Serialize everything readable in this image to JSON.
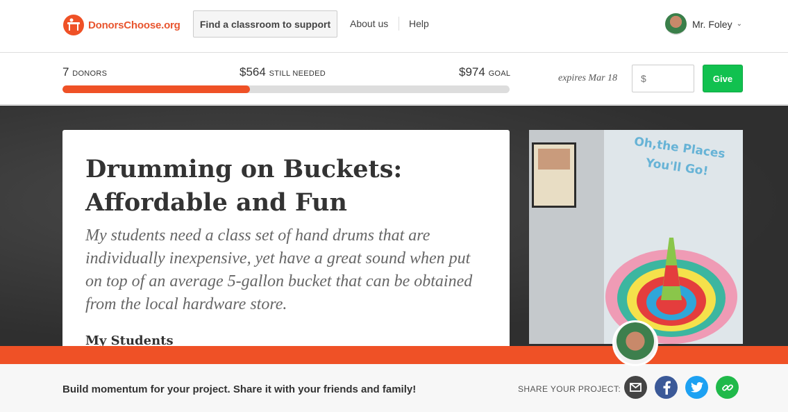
{
  "header": {
    "logo_text": "DonorsChoose.org",
    "find_button": "Find a classroom to support",
    "nav": [
      "About us",
      "Help"
    ],
    "user_name": "Mr. Foley"
  },
  "progress": {
    "donors_count": "7",
    "donors_label": "DONORS",
    "needed_amount": "$564",
    "needed_label": "STILL NEEDED",
    "goal_amount": "$974",
    "goal_label": "GOAL",
    "funded_fraction": 0.42,
    "expires": "expires Mar 18",
    "give_placeholder": "$",
    "give_button": "Give"
  },
  "project": {
    "title": "Drumming on Buckets: Affordable and Fun",
    "description": "My students need a class set of hand drums that are individually inexpensive, yet have a great sound when put on top of an average 5-gallon bucket that can be obtained from the local hardware store.",
    "section_heading": "My Students",
    "photo_quote": "Oh,the Places You'll Go!"
  },
  "share": {
    "message": "Build momentum for your project. Share it with your friends and family!",
    "label": "SHARE YOUR PROJECT:",
    "icons": [
      "mail-icon",
      "facebook-icon",
      "twitter-icon",
      "link-icon"
    ]
  },
  "colors": {
    "brand_orange": "#ef5126",
    "give_green": "#11c14f"
  }
}
